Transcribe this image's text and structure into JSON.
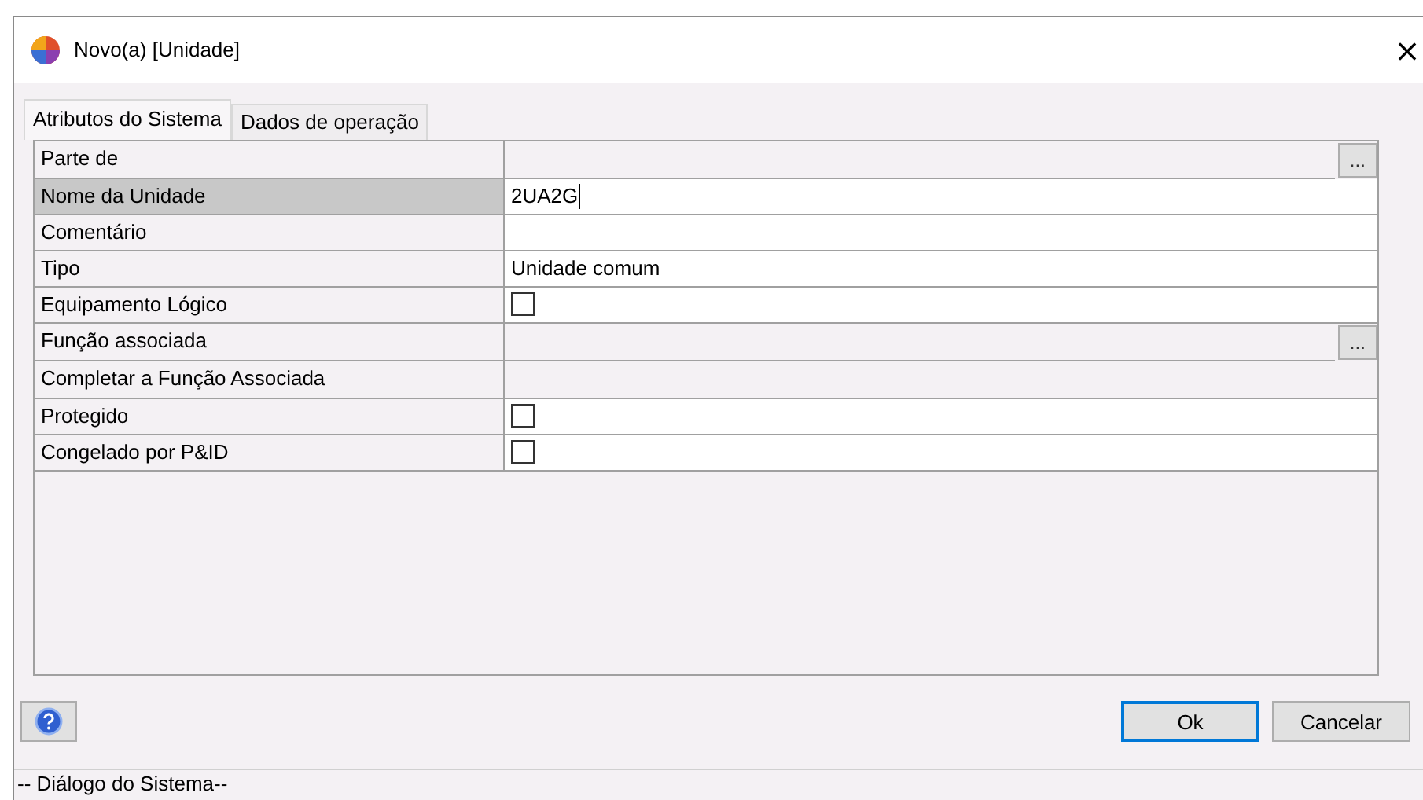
{
  "window": {
    "title": "Novo(a) [Unidade]",
    "close": "×"
  },
  "tabs": [
    {
      "label": "Atributos do Sistema",
      "selected": true
    },
    {
      "label": "Dados de operação",
      "selected": false
    }
  ],
  "properties": [
    {
      "label": "Parte de",
      "kind": "readonly",
      "selected": false,
      "button": "..."
    },
    {
      "label": "Nome da Unidade",
      "kind": "text",
      "selected": true,
      "value": "2UA2G"
    },
    {
      "label": "Comentário",
      "kind": "text",
      "selected": false
    },
    {
      "label": "Tipo",
      "kind": "text",
      "selected": false,
      "value": "Unidade comum"
    },
    {
      "label": "Equipamento Lógico",
      "kind": "checkbox",
      "selected": false,
      "checked": false
    },
    {
      "label": "Função associada",
      "kind": "readonly",
      "selected": false,
      "button": "..."
    },
    {
      "label": "Completar a Função Associada",
      "kind": "readonly",
      "selected": false
    },
    {
      "label": "Protegido",
      "kind": "checkbox",
      "selected": false,
      "checked": false
    },
    {
      "label": "Congelado por P&ID",
      "kind": "checkbox",
      "selected": false,
      "checked": false
    }
  ],
  "buttons": [
    {
      "label": "Ok",
      "default": true
    },
    {
      "label": "Cancelar",
      "default": false
    }
  ],
  "status_bar": "-- Diálogo do Sistema--"
}
